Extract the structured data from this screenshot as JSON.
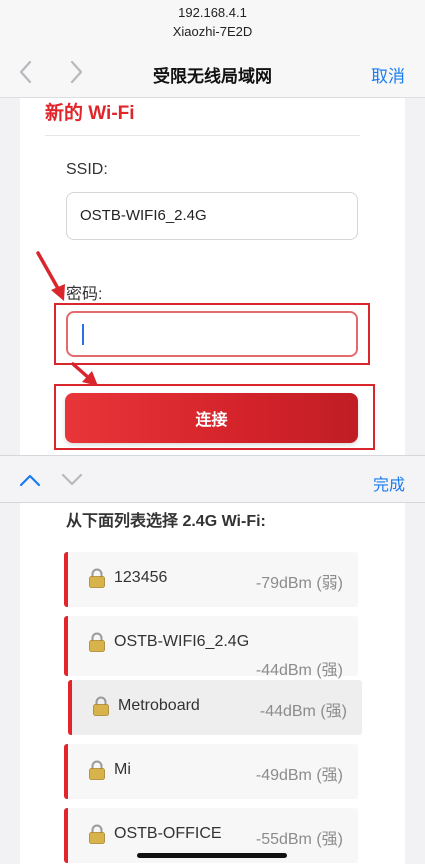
{
  "browser": {
    "address": "192.168.4.1",
    "host": "Xiaozhi-7E2D",
    "title": "受限无线局域网",
    "cancel_label": "取消"
  },
  "form": {
    "title": "新的 Wi-Fi",
    "ssid_label": "SSID:",
    "ssid_value": "OSTB-WIFI6_2.4G",
    "password_label": "密码:",
    "password_value": "",
    "connect_label": "连接"
  },
  "accessory": {
    "done_label": "完成"
  },
  "network_list": {
    "heading": "从下面列表选择 2.4G Wi-Fi:",
    "items": [
      {
        "ssid": "123456",
        "signal": "-79dBm (弱)"
      },
      {
        "ssid": "OSTB-WIFI6_2.4G",
        "signal": "-44dBm (强)"
      },
      {
        "ssid": "Metroboard",
        "signal": "-44dBm (强)"
      },
      {
        "ssid": "Mi",
        "signal": "-49dBm (强)"
      },
      {
        "ssid": "OSTB-OFFICE",
        "signal": "-55dBm (强)"
      }
    ]
  },
  "colors": {
    "accent_red": "#e0262b",
    "link_blue": "#1a7cf0",
    "highlight_red": "#d9262d"
  }
}
